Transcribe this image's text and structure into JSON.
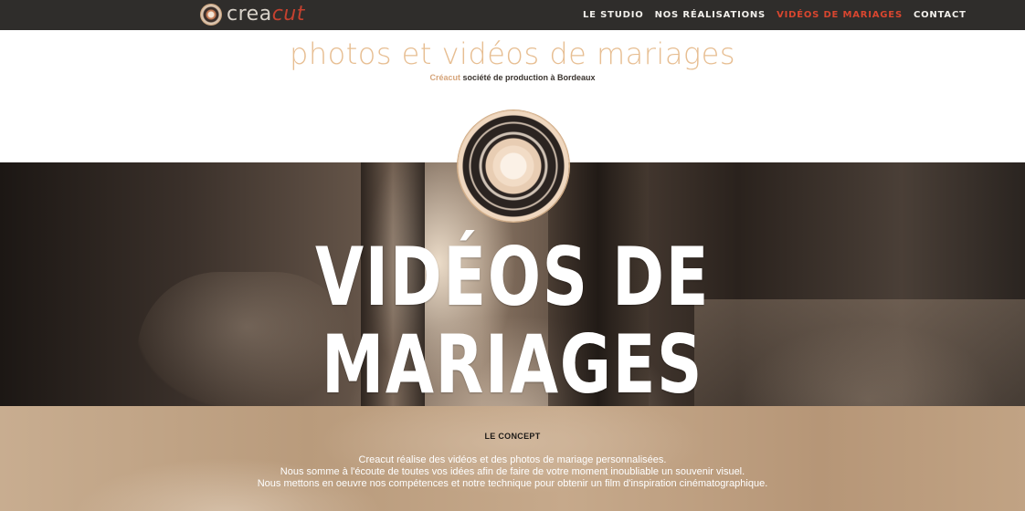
{
  "header": {
    "logo": {
      "text_part1": "crea",
      "text_part2": "cut",
      "icon": "lens-logo-icon"
    },
    "nav": [
      {
        "label": "LE STUDIO",
        "active": false
      },
      {
        "label": "NOS RÉALISATIONS",
        "active": false
      },
      {
        "label": "VIDÉOS DE MARIAGES",
        "active": true
      },
      {
        "label": "CONTACT",
        "active": false
      }
    ],
    "colors": {
      "bar": "#2f2d2b",
      "active": "#d9462f",
      "accent": "#e7be92"
    }
  },
  "intro": {
    "tagline": "photos et vidéos de mariages",
    "brand": "Créacut",
    "subline": "société de production à Bordeaux"
  },
  "hero": {
    "title": "VIDÉOS DE MARIAGES",
    "emblem": "camera-lens-icon"
  },
  "concept": {
    "heading": "LE CONCEPT",
    "lines": [
      "Creacut réalise des vidéos et des photos de mariage personnalisées.",
      "Nous somme à l'écoute de toutes vos idées afin de faire de votre moment inoubliable un souvenir visuel.",
      "Nous mettons en oeuvre nos compétences et notre technique pour obtenir un film d'inspiration cinématographique."
    ]
  }
}
